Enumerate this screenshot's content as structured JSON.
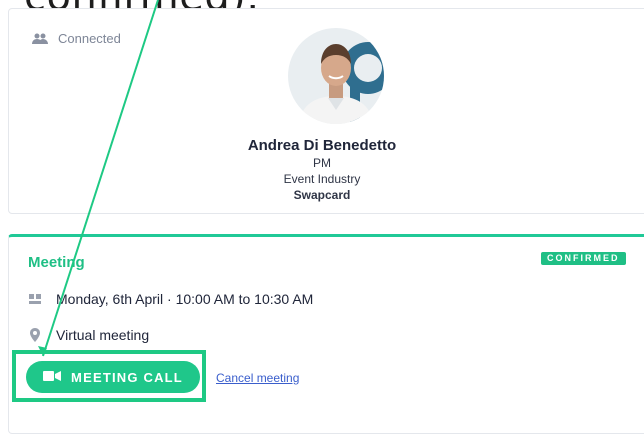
{
  "overlay": {
    "caption": "confirmed)."
  },
  "contact": {
    "status_label": "Connected",
    "name": "Andrea Di Benedetto",
    "title": "PM",
    "industry": "Event Industry",
    "company": "Swapcard"
  },
  "meeting": {
    "heading": "Meeting",
    "status_badge": "CONFIRMED",
    "date_time": "Monday, 6th April · 10:00 AM to 10:30 AM",
    "location": "Virtual meeting",
    "call_button_label": "MEETING CALL",
    "cancel_link": "Cancel meeting"
  },
  "colors": {
    "accent": "#1fc78a",
    "link": "#3a5ecc",
    "annotation": "#1ec984"
  },
  "icons": [
    "people-icon",
    "calendar-icon",
    "location-pin-icon",
    "video-camera-icon"
  ]
}
